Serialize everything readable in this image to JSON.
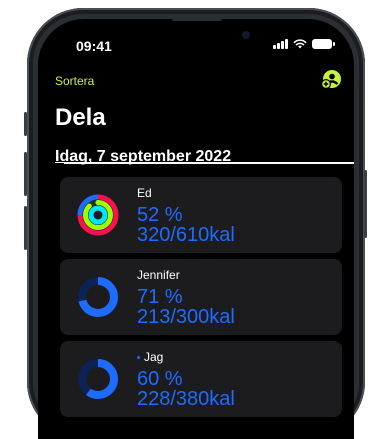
{
  "status_bar": {
    "time": "09:41"
  },
  "nav": {
    "sort_label": "Sortera"
  },
  "page": {
    "title": "Dela",
    "date_header": "Idag, 7 september 2022"
  },
  "colors": {
    "accent": "#c3f33a",
    "move": "#fa1151",
    "exercise": "#a0ff00",
    "stand": "#00e5ff",
    "calorie_blue": "#1e6bff"
  },
  "people": [
    {
      "name": "Ed",
      "percent": "52 %",
      "calories": "320/610kal",
      "progress": 0.52,
      "ring_type": "activity-rings-icon"
    },
    {
      "name": "Jennifer",
      "percent": "71 %",
      "calories": "213/300kal",
      "progress": 0.71,
      "ring_type": "calorie-ring-icon"
    },
    {
      "name": "Jag",
      "percent": "60 %",
      "calories": "228/380kal",
      "progress": 0.6,
      "ring_type": "calorie-ring-icon"
    }
  ]
}
